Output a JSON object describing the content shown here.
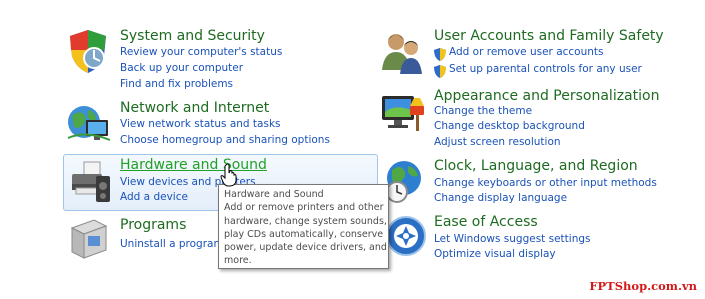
{
  "categories": {
    "system_security": {
      "title": "System and Security",
      "links": [
        "Review your computer's status",
        "Back up your computer",
        "Find and fix problems"
      ]
    },
    "network": {
      "title": "Network and Internet",
      "links": [
        "View network status and tasks",
        "Choose homegroup and sharing options"
      ]
    },
    "hardware": {
      "title": "Hardware and Sound",
      "links": [
        "View devices and printers",
        "Add a device"
      ]
    },
    "programs": {
      "title": "Programs",
      "links": [
        "Uninstall a program"
      ]
    },
    "user_accounts": {
      "title": "User Accounts and Family Safety",
      "links": [
        "Add or remove user accounts",
        "Set up parental controls for any user"
      ]
    },
    "appearance": {
      "title": "Appearance and Personalization",
      "links": [
        "Change the theme",
        "Change desktop background",
        "Adjust screen resolution"
      ]
    },
    "clock": {
      "title": "Clock, Language, and Region",
      "links": [
        "Change keyboards or other input methods",
        "Change display language"
      ]
    },
    "ease": {
      "title": "Ease of Access",
      "links": [
        "Let Windows suggest settings",
        "Optimize visual display"
      ]
    }
  },
  "tooltip": {
    "title": "Hardware and Sound",
    "lines": [
      "Add or remove printers and other",
      "hardware, change system sounds,",
      "play CDs automatically, conserve",
      "power, update device drivers, and",
      "more."
    ]
  },
  "watermark": "FPTShop.com.vn",
  "icons": {
    "system_security": "security-shield-icon",
    "network": "network-globe-icon",
    "hardware": "printer-speaker-icon",
    "programs": "programs-box-icon",
    "user_accounts": "users-icon",
    "appearance": "monitor-paint-icon",
    "clock": "globe-clock-icon",
    "ease": "ease-of-access-icon",
    "uac": "uac-shield-icon",
    "cursor": "hand-cursor-icon"
  },
  "colors": {
    "category_title": "#1e6b21",
    "category_title_hover": "#20a124",
    "link": "#1a52b8",
    "watermark": "#d21a1a"
  }
}
